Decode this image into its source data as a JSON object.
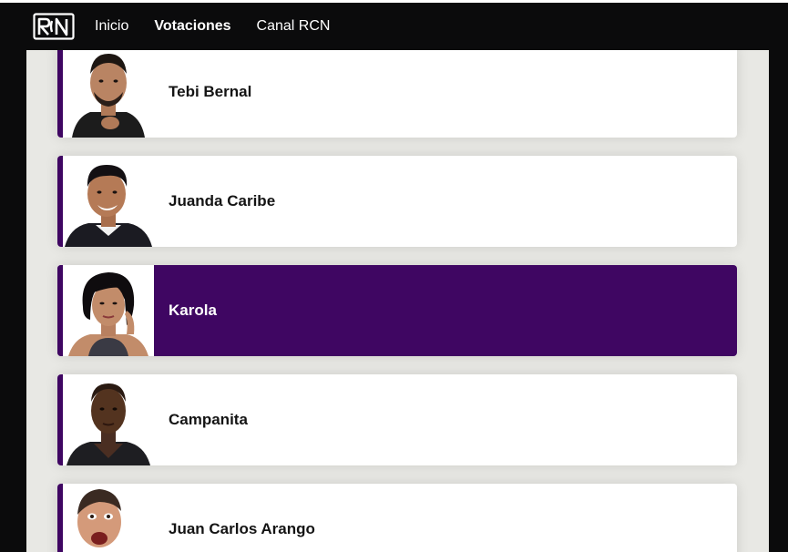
{
  "colors": {
    "accent": "#3f0662",
    "topbar": "#0b0b0c",
    "page_bg": "#e8e8e4"
  },
  "header": {
    "logo_icon": "rcn-logo-icon",
    "nav": [
      "Inicio",
      "Votaciones",
      "Canal RCN"
    ],
    "active_nav": "Votaciones"
  },
  "contestants": [
    {
      "name": "Tebi Bernal",
      "selected": false
    },
    {
      "name": "Juanda Caribe",
      "selected": false
    },
    {
      "name": "Karola",
      "selected": true
    },
    {
      "name": "Campanita",
      "selected": false
    },
    {
      "name": "Juan Carlos Arango",
      "selected": false
    }
  ]
}
